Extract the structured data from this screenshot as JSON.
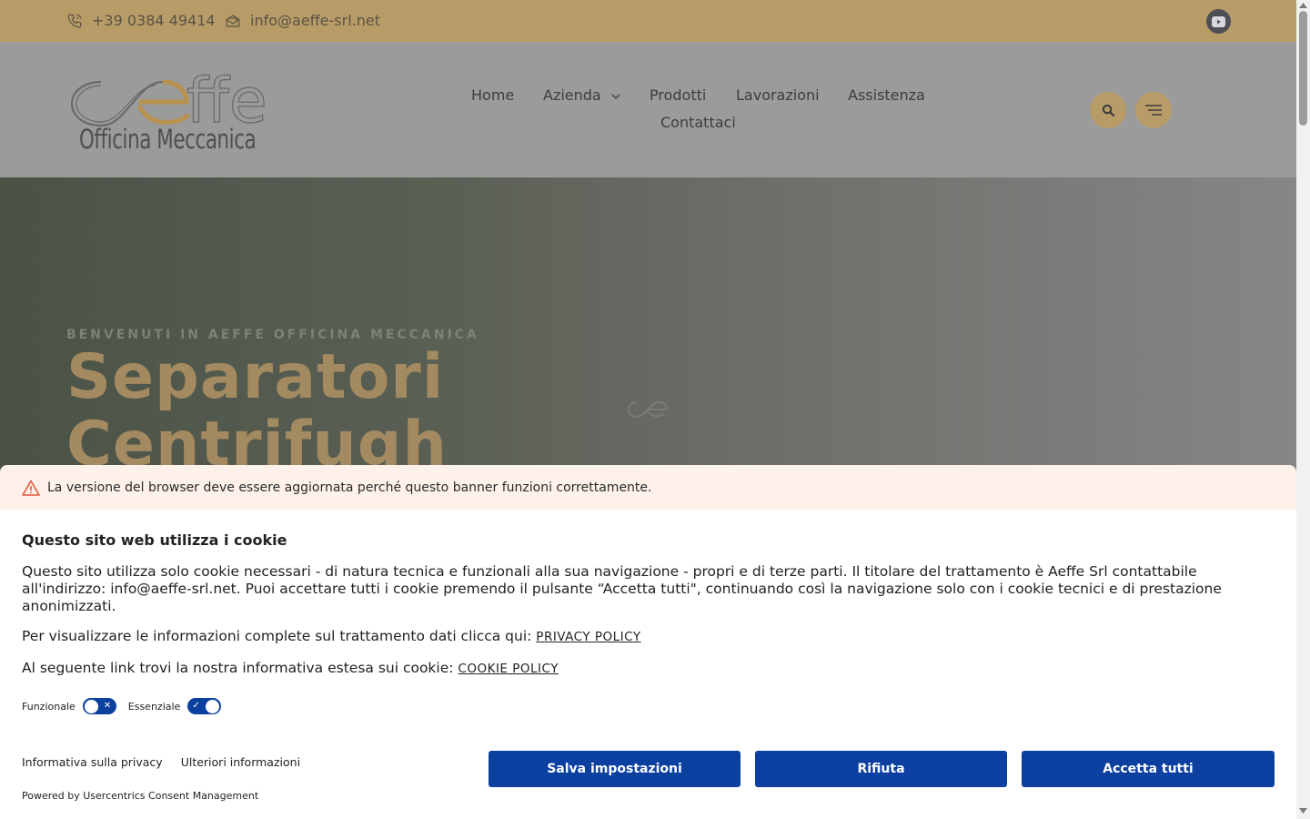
{
  "topbar": {
    "phone": "+39 0384 49414",
    "email": "info@aeffe-srl.net",
    "icons": [
      "phone-icon",
      "mail-icon",
      "youtube-icon"
    ]
  },
  "header": {
    "logo_text": "aeffe",
    "logo_subtitle": "Officina Meccanica",
    "nav": [
      "Home",
      "Azienda",
      "Prodotti",
      "Lavorazioni",
      "Assistenza",
      "Contattaci"
    ],
    "icons": [
      "search-icon",
      "menu-icon"
    ]
  },
  "hero": {
    "kicker": "BENVENUTI IN AEFFE OFFICINA MECCANICA",
    "title_line1": "Separatori",
    "title_line2": "Centrifugh"
  },
  "consent": {
    "warning": "La versione del browser deve essere aggiornata perché questo banner funzioni correttamente.",
    "heading": "Questo sito web utilizza i cookie",
    "body": "Questo sito utilizza solo cookie necessari - di natura tecnica e funzionali alla sua navigazione - propri e di terze parti. Il titolare del trattamento è Aeffe Srl contattabile all'indirizzo: info@aeffe-srl.net. Puoi accettare tutti i cookie premendo il pulsante “Accetta tutti\", continuando così la navigazione solo con i cookie tecnici e di prestazione anonimizzati.",
    "privacy_text": "Per visualizzare le informazioni complete sul trattamento dati clicca qui:",
    "privacy_link": "PRIVACY POLICY",
    "cookie_text": "Al seguente link trovi la nostra informativa estesa sui cookie:",
    "cookie_link": "COOKIE POLICY",
    "toggle_functional": "Funzionale",
    "toggle_essential": "Essenziale",
    "footer_privacy": "Informativa sulla privacy",
    "footer_more": "Ulteriori informazioni",
    "powered": "Powered by Usercentrics Consent Management",
    "btn_save": "Salva impostazioni",
    "btn_reject": "Rifiuta",
    "btn_accept": "Accetta tutti",
    "accent": "#0b3fa0"
  },
  "colors": {
    "brand_gold": "#b89c68"
  }
}
